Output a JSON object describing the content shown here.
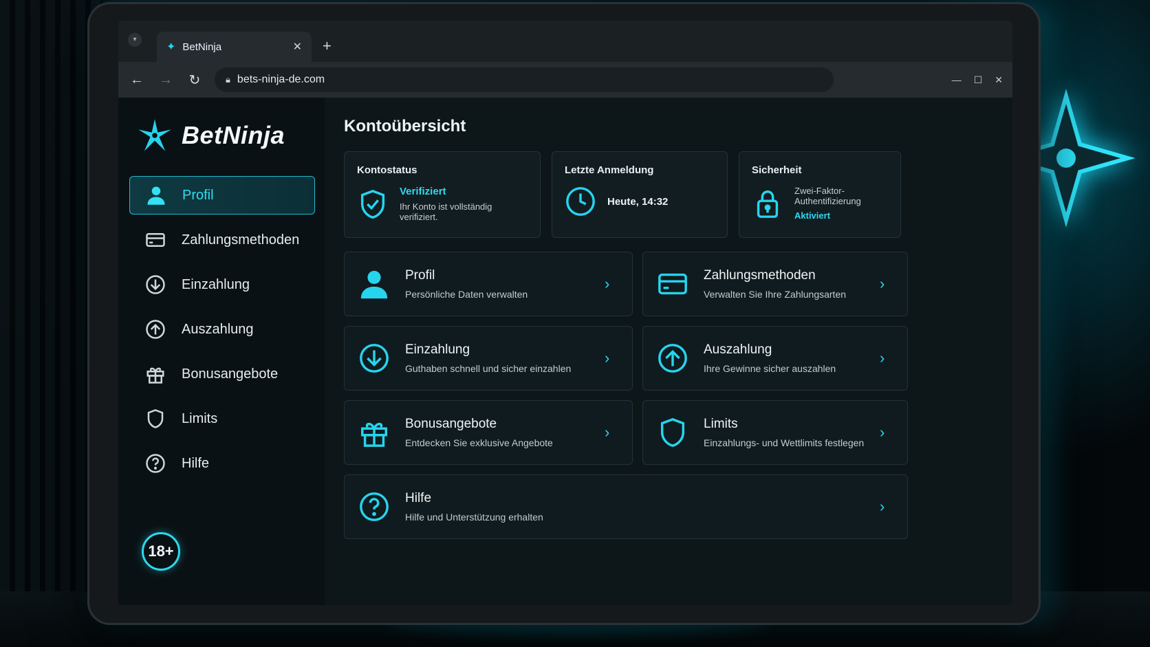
{
  "browser": {
    "tab_title": "BetNinja",
    "url": "bets-ninja-de.com",
    "nav": {
      "back": "←",
      "forward": "→",
      "reload": "↻"
    },
    "window_controls": {
      "minimize": "—",
      "maximize": "☐",
      "close": "✕"
    },
    "new_tab": "+",
    "tab_close": "✕"
  },
  "brand": {
    "name": "BetNinja",
    "accent_color": "#27d4ee"
  },
  "sidebar": {
    "items": [
      {
        "label": "Profil",
        "icon": "user-icon",
        "active": true
      },
      {
        "label": "Zahlungsmethoden",
        "icon": "credit-card-icon"
      },
      {
        "label": "Einzahlung",
        "icon": "arrow-down-circle-icon"
      },
      {
        "label": "Auszahlung",
        "icon": "arrow-up-circle-icon"
      },
      {
        "label": "Bonusangebote",
        "icon": "gift-icon"
      },
      {
        "label": "Limits",
        "icon": "shield-icon"
      },
      {
        "label": "Hilfe",
        "icon": "question-circle-icon"
      }
    ],
    "age_badge": "18+"
  },
  "main": {
    "title": "Kontoübersicht",
    "status": {
      "account": {
        "title": "Kontostatus",
        "value": "Verifiziert",
        "sub": "Ihr Konto ist vollständig verifiziert."
      },
      "login": {
        "title": "Letzte Anmeldung",
        "value": "Heute, 14:32"
      },
      "security": {
        "title": "Sicherheit",
        "value": "Zwei-Faktor-Authentifizierung",
        "sub": "Aktiviert"
      }
    },
    "tiles": [
      {
        "title": "Profil",
        "sub": "Persönliche Daten verwalten"
      },
      {
        "title": "Zahlungsmethoden",
        "sub": "Verwalten Sie Ihre Zahlungsarten"
      },
      {
        "title": "Einzahlung",
        "sub": "Guthaben schnell und sicher einzahlen"
      },
      {
        "title": "Auszahlung",
        "sub": "Ihre Gewinne sicher auszahlen"
      },
      {
        "title": "Bonusangebote",
        "sub": "Entdecken Sie exklusive Angebote"
      },
      {
        "title": "Limits",
        "sub": "Einzahlungs- und Wettlimits festlegen"
      },
      {
        "title": "Hilfe",
        "sub": "Hilfe und Unterstützung erhalten"
      }
    ]
  }
}
